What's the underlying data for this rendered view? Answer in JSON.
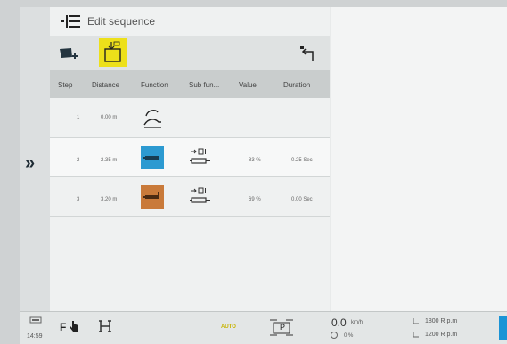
{
  "title": "Edit sequence",
  "table": {
    "headers": [
      "Step",
      "Distance",
      "Function",
      "Sub fun...",
      "Value",
      "Duration"
    ],
    "rows": [
      {
        "step": "1",
        "distance": "0.00 m",
        "value": "",
        "duration": ""
      },
      {
        "step": "2",
        "distance": "2.35 m",
        "value": "83 %",
        "duration": "0.25 Sec"
      },
      {
        "step": "3",
        "distance": "3.20 m",
        "value": "69 %",
        "duration": "0.00 Sec"
      }
    ]
  },
  "status": {
    "time": "14:59",
    "mode_f": "F",
    "auto": "AUTO",
    "gear": "P",
    "speed_value": "0.0",
    "speed_unit": "km/h",
    "slip": "0 %",
    "rpm1": "1800 R.p.m",
    "rpm2": "1200 R.p.m"
  },
  "colors": {
    "accent_yellow": "#ede01a",
    "function_blue": "#2c9ad1",
    "function_brown": "#c97a3a"
  }
}
